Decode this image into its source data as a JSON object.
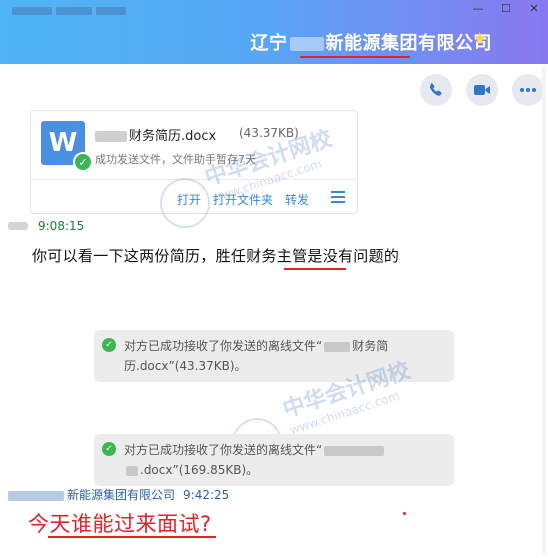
{
  "header": {
    "title_prefix": "辽宁",
    "title_suffix": "新能源集团有限公司",
    "star": "★",
    "controls": {
      "minimize": "—",
      "maximize": "☐",
      "close": "✕"
    }
  },
  "actions": {
    "call_icon": "phone-icon",
    "video_icon": "video-icon",
    "more_icon": "more-icon"
  },
  "file_card": {
    "icon_letter": "W",
    "name": "财务简历.docx",
    "size": "(43.37KB)",
    "status": "成功发送文件，文件助手暂存7天",
    "actions": [
      "打开",
      "打开文件夹",
      "转发"
    ]
  },
  "message": {
    "time": "9:08:15",
    "text": "你可以看一下这两份简历，胜任财务主管是没有问题的"
  },
  "system_notices": [
    {
      "line1": "对方已成功接收了你发送的离线文件“",
      "file_part": "财务简",
      "line2": "历.docx”(43.37KB)。"
    },
    {
      "line1": "对方已成功接收了你发送的离线文件“",
      "file_part": "",
      "line2": ".docx”(169.85KB)。"
    }
  ],
  "reply": {
    "sender_suffix": "新能源集团有限公司",
    "time": "9:42:25",
    "text": "今天谁能过来面试?"
  },
  "watermark": {
    "cn": "中华会计网校",
    "url": "www.chinaacc.com"
  },
  "colors": {
    "accent_red": "#e0242a",
    "link_blue": "#3a89d8",
    "header_gradient_start": "#4fb5f4",
    "header_gradient_end": "#8a78f0"
  }
}
